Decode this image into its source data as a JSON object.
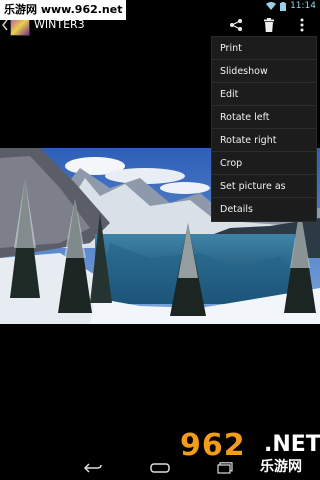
{
  "status_bar": {
    "time": "11:14"
  },
  "watermark": {
    "top_text": "乐游网 www.962.net",
    "bottom_number": "962",
    "bottom_suffix": ".NET",
    "bottom_cn": "乐游网"
  },
  "action_bar": {
    "title": "WINTER3",
    "icons": [
      "share-icon",
      "delete-icon",
      "overflow-menu-icon"
    ]
  },
  "menu": {
    "items": [
      {
        "label": "Print"
      },
      {
        "label": "Slideshow"
      },
      {
        "label": "Edit"
      },
      {
        "label": "Rotate left"
      },
      {
        "label": "Rotate right"
      },
      {
        "label": "Crop"
      },
      {
        "label": "Set picture as"
      },
      {
        "label": "Details"
      }
    ]
  },
  "nav_bar": {
    "icons": [
      "back-icon",
      "home-icon",
      "recents-icon"
    ]
  },
  "colors": {
    "background": "#000000",
    "menu_background": "#1c1c1c",
    "watermark_orange": "#f39c1a",
    "status_icon_tint": "#9ad1e6"
  }
}
